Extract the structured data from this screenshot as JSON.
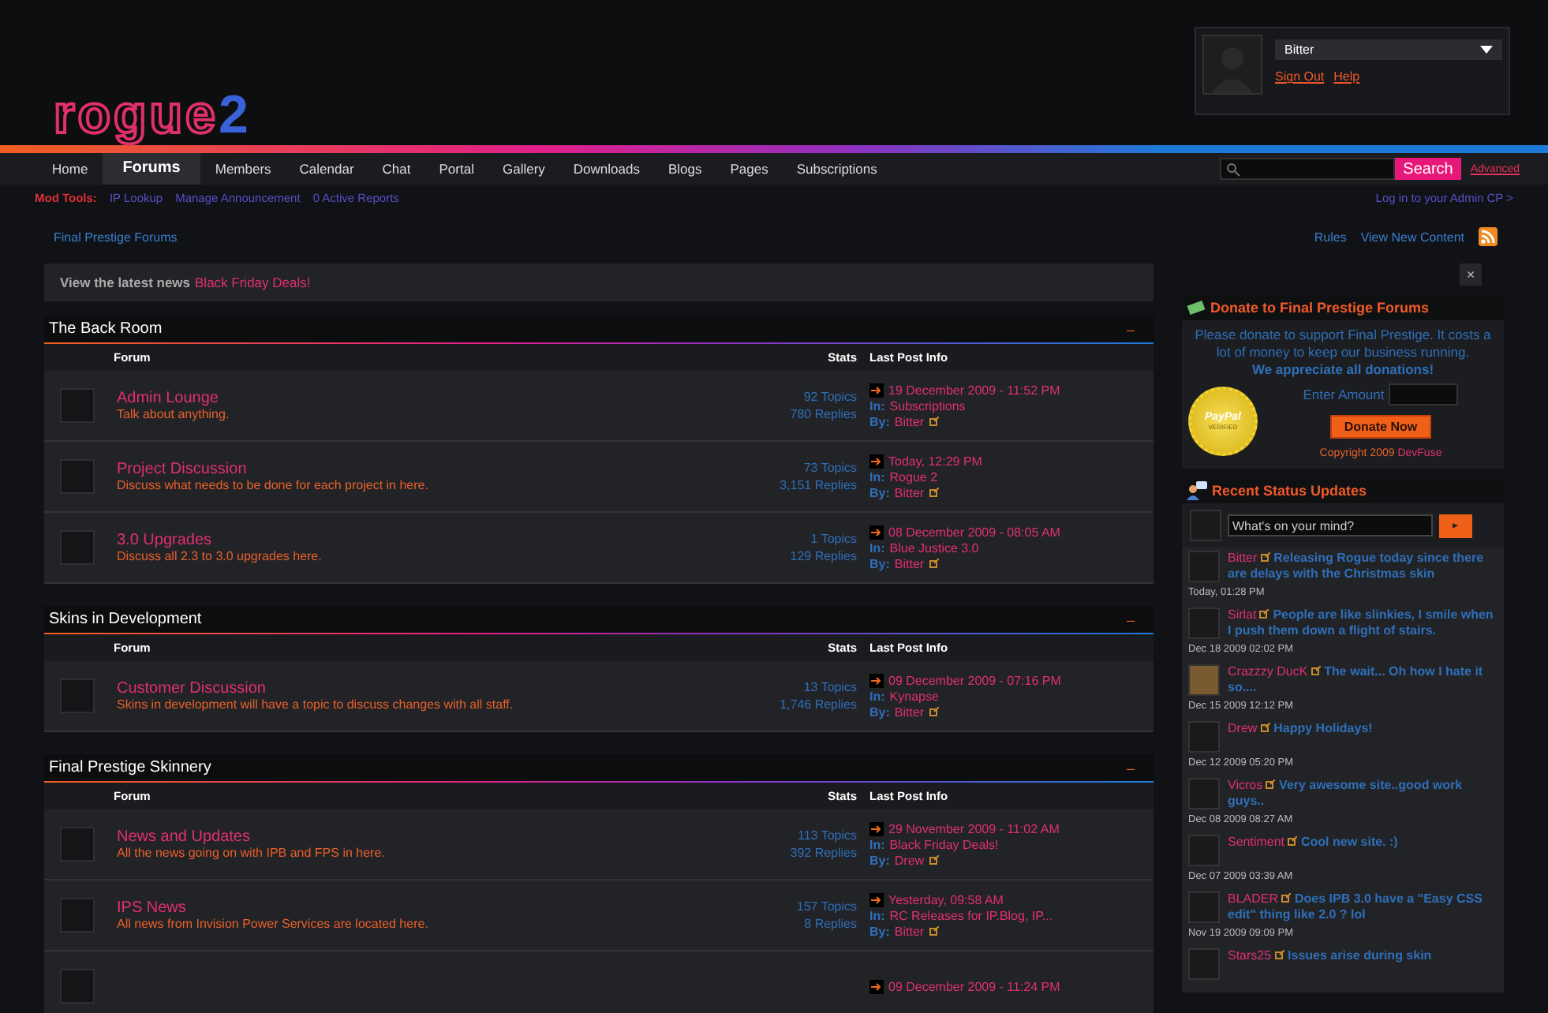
{
  "header": {
    "logo": {
      "text": "rogue",
      "accent": "2"
    },
    "user": {
      "name": "Bitter",
      "links": [
        "Sign Out",
        "Help"
      ]
    }
  },
  "nav": [
    {
      "label": "Home",
      "selected": false
    },
    {
      "label": "Forums",
      "selected": true
    },
    {
      "label": "Members",
      "selected": false
    },
    {
      "label": "Calendar",
      "selected": false
    },
    {
      "label": "Chat",
      "selected": false
    },
    {
      "label": "Portal",
      "selected": false
    },
    {
      "label": "Gallery",
      "selected": false
    },
    {
      "label": "Downloads",
      "selected": false
    },
    {
      "label": "Blogs",
      "selected": false
    },
    {
      "label": "Pages",
      "selected": false
    },
    {
      "label": "Subscriptions",
      "selected": false
    }
  ],
  "search": {
    "button": "Search",
    "advanced": "Advanced"
  },
  "mod_tools": {
    "label": "Mod Tools:",
    "links": [
      "IP Lookup",
      "Manage Announcement",
      "0 Active Reports"
    ],
    "admin_link": "Log in to your Admin CP >"
  },
  "breadcrumb": "Final Prestige Forums",
  "top_links": [
    "Rules",
    "View New Content"
  ],
  "news": {
    "label": "View the latest news",
    "link": "Black Friday Deals!"
  },
  "categories": [
    {
      "title": "The Back Room",
      "toggle": "–",
      "columns": [
        "Forum",
        "Stats",
        "Last Post Info"
      ],
      "forums": [
        {
          "name": "Admin Lounge",
          "description": "Talk about anything.",
          "topics": "92 Topics",
          "replies": "780 Replies",
          "date": "19 December 2009 - 11:52 PM",
          "in_label": "In:",
          "in": "Subscriptions",
          "by_label": "By:",
          "by": "Bitter"
        },
        {
          "name": "Project Discussion",
          "description": "Discuss what needs to be done for each project in here.",
          "topics": "73 Topics",
          "replies": "3,151 Replies",
          "date": "Today, 12:29 PM",
          "in_label": "In:",
          "in": "Rogue 2",
          "by_label": "By:",
          "by": "Bitter"
        },
        {
          "name": "3.0 Upgrades",
          "description": "Discuss all 2.3 to 3.0 upgrades here.",
          "topics": "1 Topics",
          "replies": "129 Replies",
          "date": "08 December 2009 - 08:05 AM",
          "in_label": "In:",
          "in": "Blue Justice 3.0",
          "by_label": "By:",
          "by": "Bitter"
        }
      ]
    },
    {
      "title": "Skins in Development",
      "toggle": "–",
      "columns": [
        "Forum",
        "Stats",
        "Last Post Info"
      ],
      "forums": [
        {
          "name": "Customer Discussion",
          "description": "Skins in development will have a topic to discuss changes with all staff.",
          "topics": "13 Topics",
          "replies": "1,746 Replies",
          "date": "09 December 2009 - 07:16 PM",
          "in_label": "In:",
          "in": "Kynapse",
          "by_label": "By:",
          "by": "Bitter"
        }
      ]
    },
    {
      "title": "Final Prestige Skinnery",
      "toggle": "–",
      "columns": [
        "Forum",
        "Stats",
        "Last Post Info"
      ],
      "forums": [
        {
          "name": "News and Updates",
          "description": "All the news going on with IPB and FPS in here.",
          "topics": "113 Topics",
          "replies": "392 Replies",
          "date": "29 November 2009 - 11:02 AM",
          "in_label": "In:",
          "in": "Black Friday Deals!",
          "by_label": "By:",
          "by": "Drew"
        },
        {
          "name": "IPS News",
          "description": "All news from Invision Power Services are located here.",
          "topics": "157 Topics",
          "replies": "8 Replies",
          "date": "Yesterday, 09:58 AM",
          "in_label": "In:",
          "in": "RC Releases for IP.Blog, IP...",
          "by_label": "By:",
          "by": "Bitter"
        },
        {
          "date": "09 December 2009 - 11:24 PM"
        }
      ]
    }
  ],
  "sidebar": {
    "close": "×",
    "donate": {
      "title": "Donate to Final Prestige Forums",
      "text": "Please donate to support Final Prestige. It costs a lot of money to keep our business running.",
      "emphasis": "We appreciate all donations!",
      "seal": [
        "PayPal",
        "VERIFIED"
      ],
      "amount_label": "Enter Amount",
      "button": "Donate Now",
      "copyright": "Copyright 2009",
      "copyright_link": "DevFuse"
    },
    "status": {
      "title": "Recent Status Updates",
      "placeholder": "What's on your mind?",
      "submit": "▸",
      "updates": [
        {
          "user": "Bitter",
          "text": "Releasing Rogue today since there are delays with the Christmas skin",
          "time": "Today, 01:28 PM",
          "photo": false
        },
        {
          "user": "Sirlat",
          "text": "People are like slinkies, I smile when I push them down a flight of stairs.",
          "time": "Dec 18 2009 02:02 PM",
          "photo": false
        },
        {
          "user": "Crazzzy DucK",
          "text": "The wait... Oh how I hate it so....",
          "time": "Dec 15 2009 12:12 PM",
          "photo": true
        },
        {
          "user": "Drew",
          "text": "Happy Holidays!",
          "time": "Dec 12 2009 05:20 PM",
          "photo": false
        },
        {
          "user": "Vicros",
          "text": "Very awesome site..good work guys..",
          "time": "Dec 08 2009 08:27 AM",
          "photo": false
        },
        {
          "user": "Sentiment",
          "text": "Cool new site. :)",
          "time": "Dec 07 2009 03:39 AM",
          "photo": false
        },
        {
          "user": "BLADER",
          "text": "Does IPB 3.0 have a \"Easy CSS edit\" thing like 2.0 ? lol",
          "time": "Nov 19 2009 09:09 PM",
          "photo": false
        },
        {
          "user": "Stars25",
          "text": "Issues arise during skin",
          "photo": false
        }
      ]
    }
  }
}
